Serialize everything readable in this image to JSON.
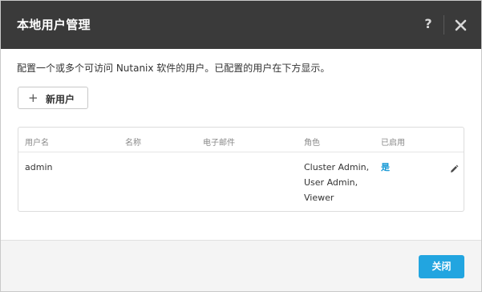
{
  "dialog": {
    "title": "本地用户管理",
    "help_label": "?",
    "description": "配置一个或多个可访问 Nutanix 软件的用户。已配置的用户在下方显示。"
  },
  "actions": {
    "new_user_label": "新用户",
    "close_label": "关闭"
  },
  "table": {
    "columns": [
      "用户名",
      "名称",
      "电子邮件",
      "角色",
      "已启用"
    ],
    "rows": [
      {
        "username": "admin",
        "name": "",
        "email": "",
        "roles": [
          "Cluster Admin,",
          "User Admin,",
          "Viewer"
        ],
        "enabled": "是"
      }
    ]
  },
  "icons": {
    "help": "question-icon",
    "close": "close-icon",
    "add": "plus-icon",
    "edit": "pencil-icon"
  },
  "colors": {
    "header_bg": "#3a3a3a",
    "accent": "#22a5e0",
    "enabled_text": "#1a9ad6"
  }
}
